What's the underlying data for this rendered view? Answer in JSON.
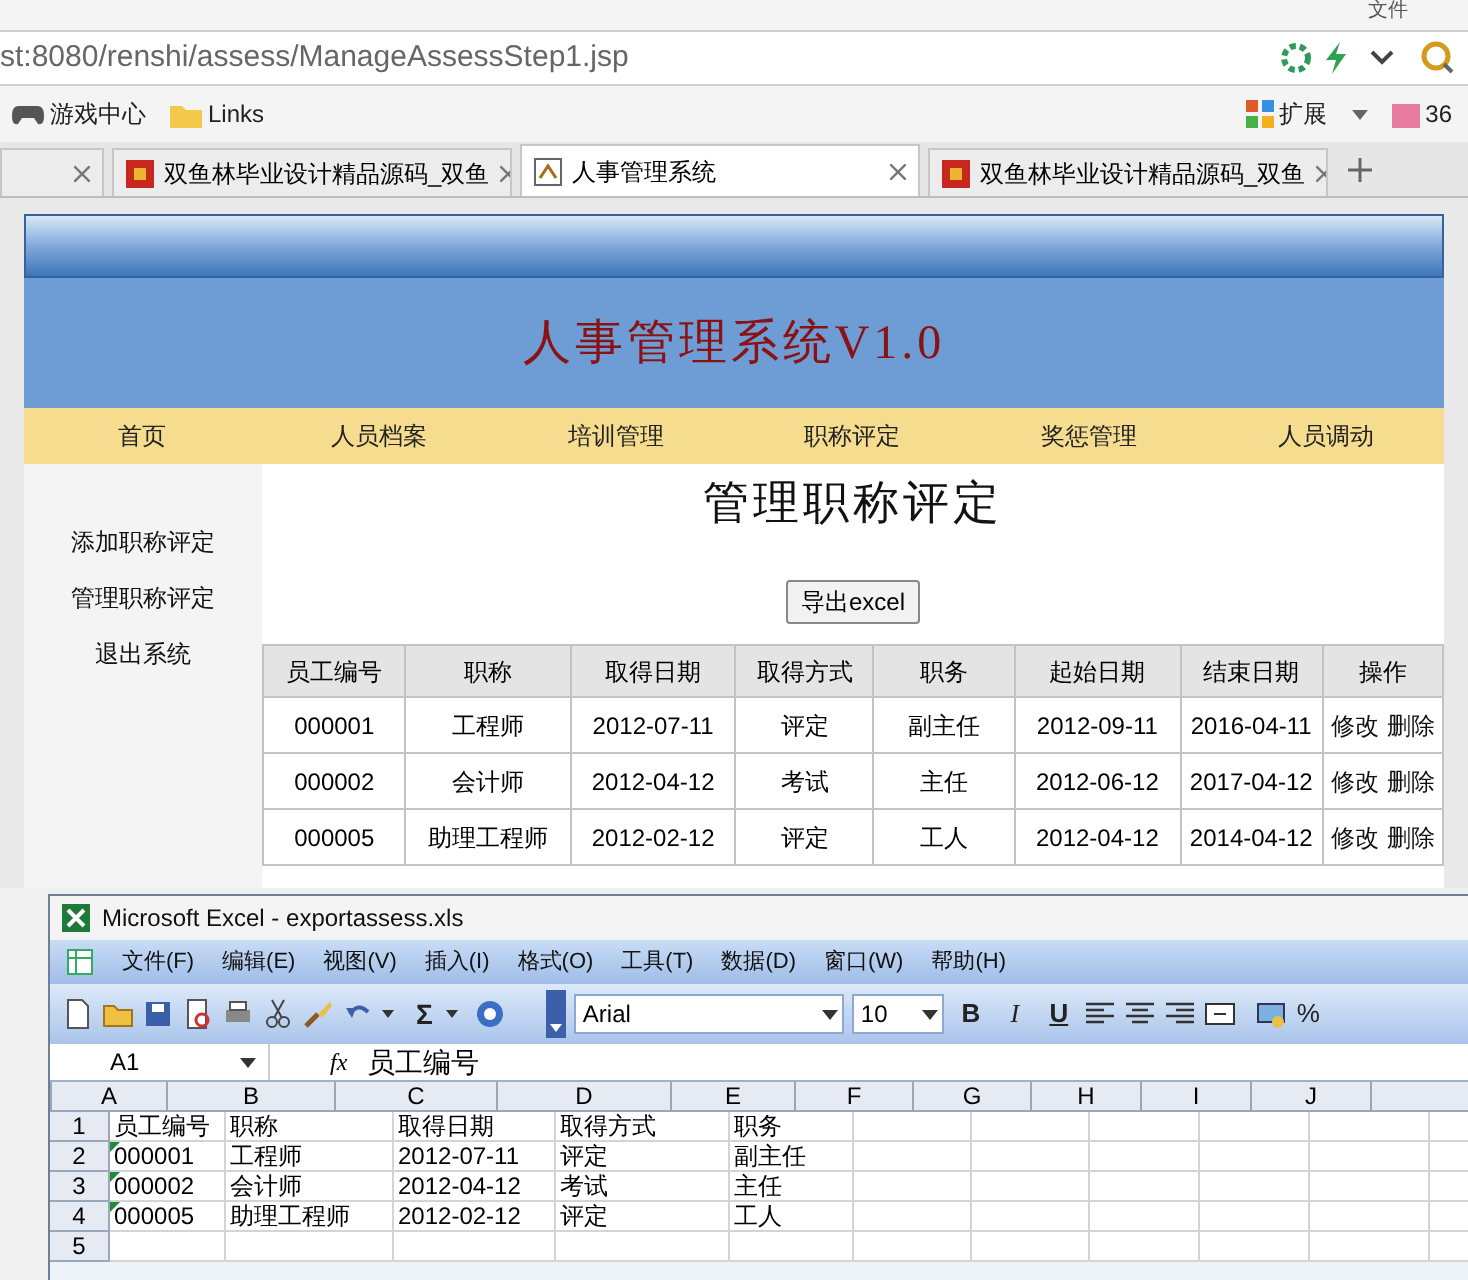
{
  "browser": {
    "menu_hint": "文件",
    "address": "st:8080/renshi/assess/ManageAssessStep1.jsp",
    "bookmarks": [
      {
        "label": "游戏中心",
        "kind": "game"
      },
      {
        "label": "Links",
        "kind": "folder"
      }
    ],
    "extensions_label": "扩展",
    "extra_label": "36",
    "tabs": [
      {
        "title": "双鱼林毕业设计精品源码_双鱼",
        "selected": false
      },
      {
        "title": "人事管理系统",
        "selected": true
      },
      {
        "title": "双鱼林毕业设计精品源码_双鱼",
        "selected": false
      }
    ]
  },
  "page": {
    "system_title": "人事管理系统V1.0",
    "nav": [
      "首页",
      "人员档案",
      "培训管理",
      "职称评定",
      "奖惩管理",
      "人员调动"
    ],
    "sidebar": [
      "添加职称评定",
      "管理职称评定",
      "退出系统"
    ],
    "heading": "管理职称评定",
    "export_button": "导出excel",
    "table": {
      "columns": [
        "员工编号",
        "职称",
        "取得日期",
        "取得方式",
        "职务",
        "起始日期",
        "结束日期",
        "操作"
      ],
      "rows": [
        {
          "cells": [
            "000001",
            "工程师",
            "2012-07-11",
            "评定",
            "副主任",
            "2012-09-11",
            "2016-04-11"
          ],
          "actions": [
            "修改",
            "删除"
          ]
        },
        {
          "cells": [
            "000002",
            "会计师",
            "2012-04-12",
            "考试",
            "主任",
            "2012-06-12",
            "2017-04-12"
          ],
          "actions": [
            "修改",
            "删除"
          ]
        },
        {
          "cells": [
            "000005",
            "助理工程师",
            "2012-02-12",
            "评定",
            "工人",
            "2012-04-12",
            "2014-04-12"
          ],
          "actions": [
            "修改",
            "删除"
          ]
        }
      ]
    }
  },
  "excel": {
    "title": "Microsoft Excel - exportassess.xls",
    "menu": [
      "文件(F)",
      "编辑(E)",
      "视图(V)",
      "插入(I)",
      "格式(O)",
      "工具(T)",
      "数据(D)",
      "窗口(W)",
      "帮助(H)"
    ],
    "sum_symbol": "Σ",
    "font": "Arial",
    "font_size": "10",
    "format_buttons": [
      "B",
      "I",
      "U"
    ],
    "percent": "%",
    "name_box": "A1",
    "fx_label": "fx",
    "formula": "员工编号",
    "columns": [
      "A",
      "B",
      "C",
      "D",
      "E",
      "F",
      "G",
      "H",
      "I",
      "J"
    ],
    "rows": [
      {
        "header": "1",
        "flagged": false,
        "cells": [
          "员工编号",
          "职称",
          "取得日期",
          "取得方式",
          "职务"
        ]
      },
      {
        "header": "2",
        "flagged": true,
        "cells": [
          "000001",
          "工程师",
          "2012-07-11",
          "评定",
          "副主任"
        ]
      },
      {
        "header": "3",
        "flagged": true,
        "cells": [
          "000002",
          "会计师",
          "2012-04-12",
          "考试",
          "主任"
        ]
      },
      {
        "header": "4",
        "flagged": true,
        "cells": [
          "000005",
          "助理工程师",
          "2012-02-12",
          "评定",
          "工人"
        ]
      },
      {
        "header": "5",
        "flagged": false,
        "cells": []
      }
    ]
  }
}
